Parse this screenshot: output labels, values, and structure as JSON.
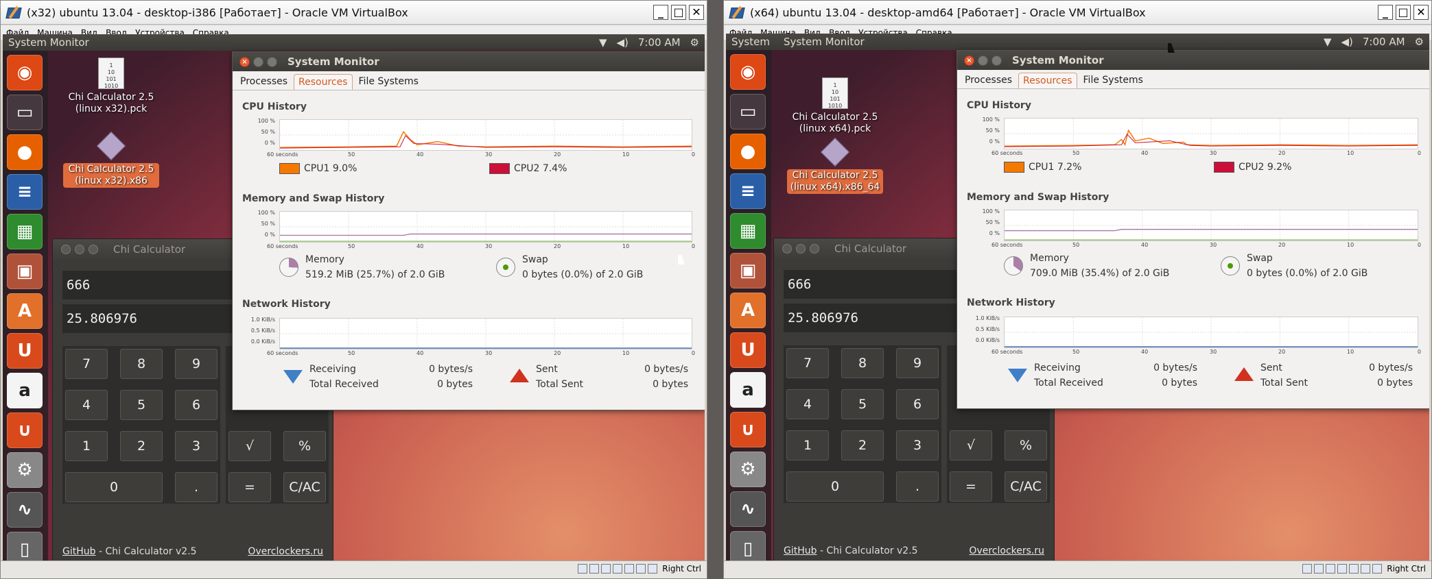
{
  "left": {
    "window_title": "(x32) ubuntu 13.04 - desktop-i386 [Работает] - Oracle VM VirtualBox",
    "menu": [
      "Файл",
      "Машина",
      "Вид",
      "Ввод",
      "Устройства",
      "Справка"
    ],
    "topbar_app": "System Monitor",
    "clock": "7:00 AM",
    "desk1_label": "Chi Calculator 2.5 (linux x32).pck",
    "desk2_label": "Chi Calculator 2.5 (linux x32).x86",
    "calc_title": "Chi Calculator",
    "calc_input": "666",
    "calc_result": "25.806976",
    "sm_title": "System Monitor",
    "tabs": [
      "Processes",
      "Resources",
      "File Systems"
    ],
    "cpu_h": "CPU History",
    "mem_h": "Memory and Swap History",
    "net_h": "Network History",
    "cpu1": "CPU1  9.0%",
    "cpu2": "CPU2  7.4%",
    "mem_label": "Memory",
    "mem_val": "519.2 MiB (25.7%) of 2.0 GiB",
    "swap_label": "Swap",
    "swap_val": "0 bytes (0.0%) of 2.0 GiB",
    "receiving": "Receiving",
    "receiving_val": "0 bytes/s",
    "total_received": "Total Received",
    "total_received_val": "0 bytes",
    "sent": "Sent",
    "sent_val": "0 bytes/s",
    "total_sent": "Total Sent",
    "total_sent_val": "0 bytes",
    "status_key": "Right Ctrl"
  },
  "right": {
    "window_title": "(x64) ubuntu 13.04 - desktop-amd64 [Работает] - Oracle VM VirtualBox",
    "menu": [
      "Файл",
      "Машина",
      "Вид",
      "Ввод",
      "Устройства",
      "Справка"
    ],
    "topbar_app": "System",
    "topbar_app2": "System Monitor",
    "clock": "7:00 AM",
    "desk1_label": "Chi Calculator 2.5 (linux x64).pck",
    "desk2_label": "Chi Calculator 2.5 (linux x64).x86_64",
    "calc_title": "Chi Calculator",
    "calc_input": "666",
    "calc_result": "25.806976",
    "sm_title": "System Monitor",
    "tabs": [
      "Processes",
      "Resources",
      "File Systems"
    ],
    "cpu_h": "CPU History",
    "mem_h": "Memory and Swap History",
    "net_h": "Network History",
    "cpu1": "CPU1  7.2%",
    "cpu2": "CPU2  9.2%",
    "mem_label": "Memory",
    "mem_val": "709.0 MiB (35.4%) of 2.0 GiB",
    "swap_label": "Swap",
    "swap_val": "0 bytes (0.0%) of 2.0 GiB",
    "receiving": "Receiving",
    "receiving_val": "0 bytes/s",
    "total_received": "Total Received",
    "total_received_val": "0 bytes",
    "sent": "Sent",
    "sent_val": "0 bytes/s",
    "total_sent": "Total Sent",
    "total_sent_val": "0 bytes",
    "status_key": "Right Ctrl"
  },
  "calc_keys": [
    "7",
    "8",
    "9",
    "4",
    "5",
    "6",
    "1",
    "2",
    "3",
    "√",
    "%",
    "0",
    ".",
    "=",
    "C/AC"
  ],
  "calc_footer": {
    "github": "GitHub",
    "middle": " - Chi Calculator v2.5",
    "site": "Overclockers.ru"
  },
  "graph_axis": {
    "cpu_y": [
      "100 %",
      "50 %",
      "0 %"
    ],
    "net_y": [
      "1.0 KiB/s",
      "0.5 KiB/s",
      "0.0 KiB/s"
    ],
    "x": [
      "60 seconds",
      "50",
      "40",
      "30",
      "20",
      "10",
      "0"
    ]
  },
  "file_glyph": "1\n10\n101\n1010",
  "colors": {
    "cpu1": "#f57900",
    "cpu2": "#cc0f39",
    "memory": "#ad7fa8",
    "swap": "#4e9a06",
    "accent": "#d25a20"
  }
}
